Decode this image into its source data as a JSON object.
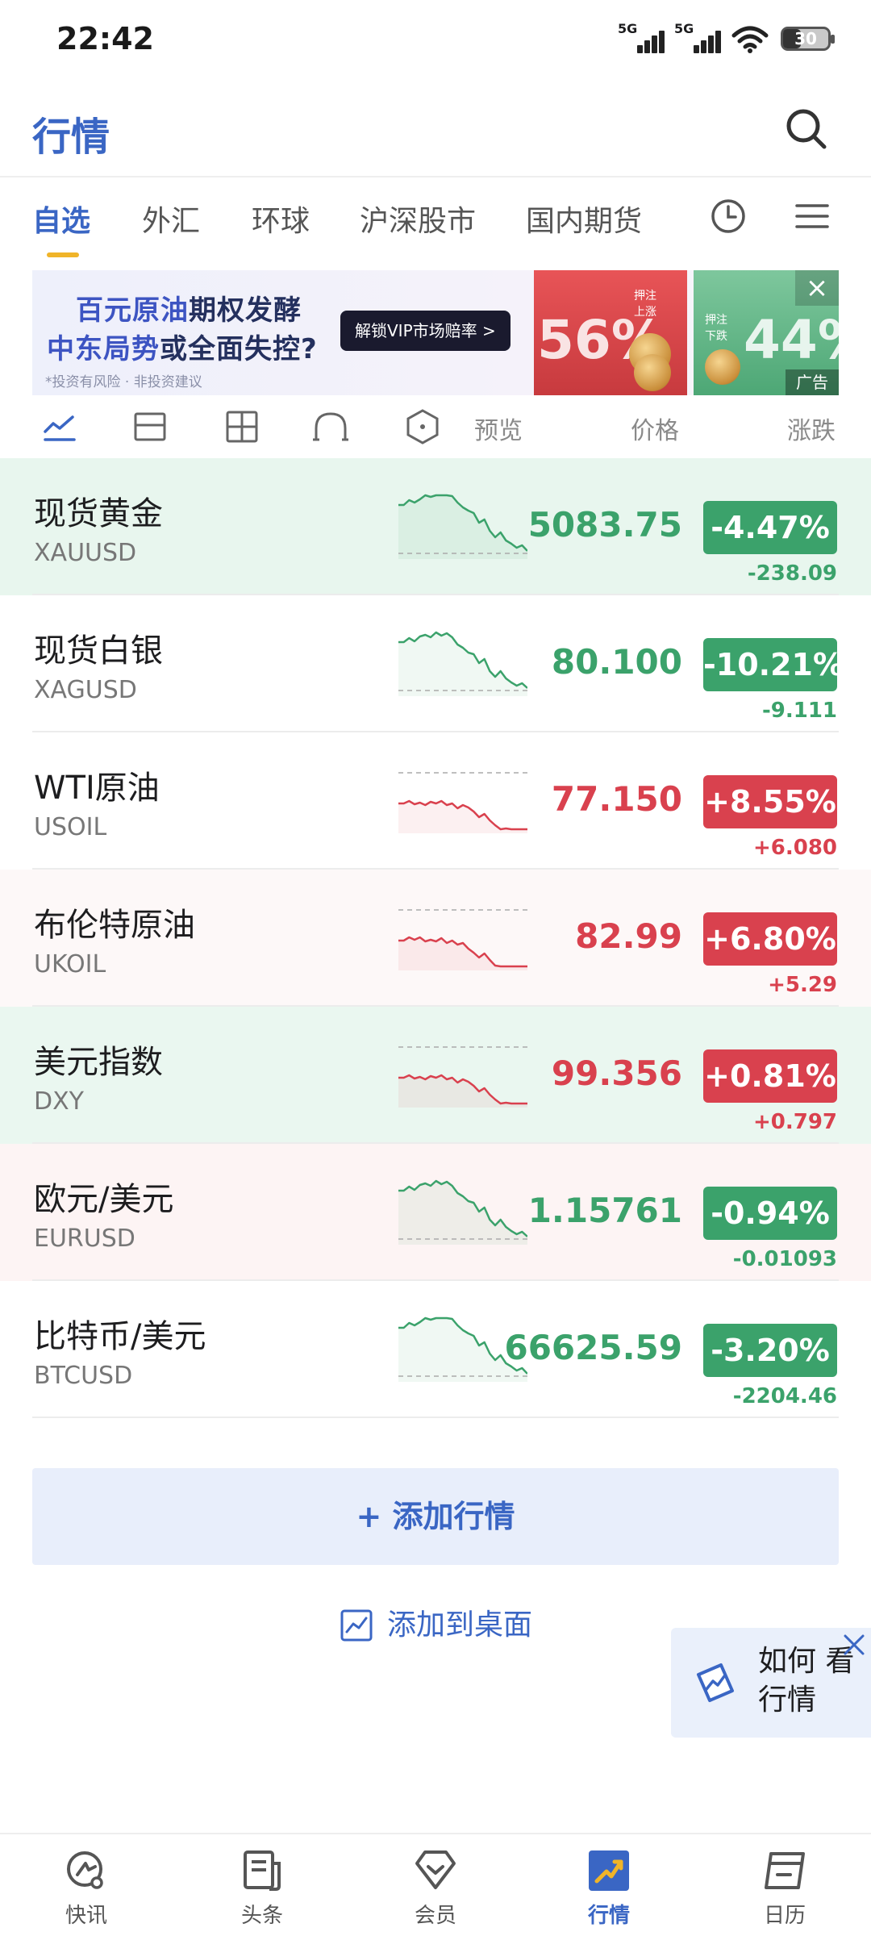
{
  "status_bar": {
    "time": "22:42",
    "net1": "5G",
    "net2": "5G",
    "battery": "30"
  },
  "header": {
    "title": "行情"
  },
  "tabs": [
    "自选",
    "外汇",
    "环球",
    "沪深股市",
    "国内期货"
  ],
  "ad": {
    "line1_hl": "百元原油",
    "line1_rest": "期权发酵",
    "line2_hl": "中东局势",
    "line2_rest": "或全面失控?",
    "disclaimer": "*投资有风险 · 非投资建议",
    "cta": "解锁VIP市场赔率 >",
    "up_pct": "56%",
    "up_label_1": "押注",
    "up_label_2": "上涨",
    "down_pct": "44%",
    "down_label_1": "押注",
    "down_label_2": "下跌",
    "tag": "广告"
  },
  "columns": {
    "preview": "预览",
    "price": "价格",
    "change": "涨跌"
  },
  "colors": {
    "up": "#d9414e",
    "down": "#3ba26b",
    "accent": "#3a66c4"
  },
  "quotes": [
    {
      "name": "现货黄金",
      "code": "XAUUSD",
      "price": "5083.75",
      "pct": "-4.47%",
      "change": "-238.09",
      "dir": "down",
      "bg": "#e8f6ee"
    },
    {
      "name": "现货白银",
      "code": "XAGUSD",
      "price": "80.100",
      "pct": "-10.21%",
      "change": "-9.111",
      "dir": "down",
      "bg": "#ffffff"
    },
    {
      "name": "WTI原油",
      "code": "USOIL",
      "price": "77.150",
      "pct": "+8.55%",
      "change": "+6.080",
      "dir": "up",
      "bg": "#ffffff"
    },
    {
      "name": "布伦特原油",
      "code": "UKOIL",
      "price": "82.99",
      "pct": "+6.80%",
      "change": "+5.29",
      "dir": "up",
      "bg": "#fdf8f8"
    },
    {
      "name": "美元指数",
      "code": "DXY",
      "price": "99.356",
      "pct": "+0.81%",
      "change": "+0.797",
      "dir": "up",
      "bg": "#eaf7f0"
    },
    {
      "name": "欧元/美元",
      "code": "EURUSD",
      "price": "1.15761",
      "pct": "-0.94%",
      "change": "-0.01093",
      "dir": "down",
      "bg": "#fdf4f4"
    },
    {
      "name": "比特币/美元",
      "code": "BTCUSD",
      "price": "66625.59",
      "pct": "-3.20%",
      "change": "-2204.46",
      "dir": "down",
      "bg": "#ffffff"
    }
  ],
  "actions": {
    "add_quote": "+ 添加行情",
    "add_desktop": "添加到桌面"
  },
  "guide": {
    "text": "如何 看行情"
  },
  "bottom_nav": [
    "快讯",
    "头条",
    "会员",
    "行情",
    "日历"
  ]
}
